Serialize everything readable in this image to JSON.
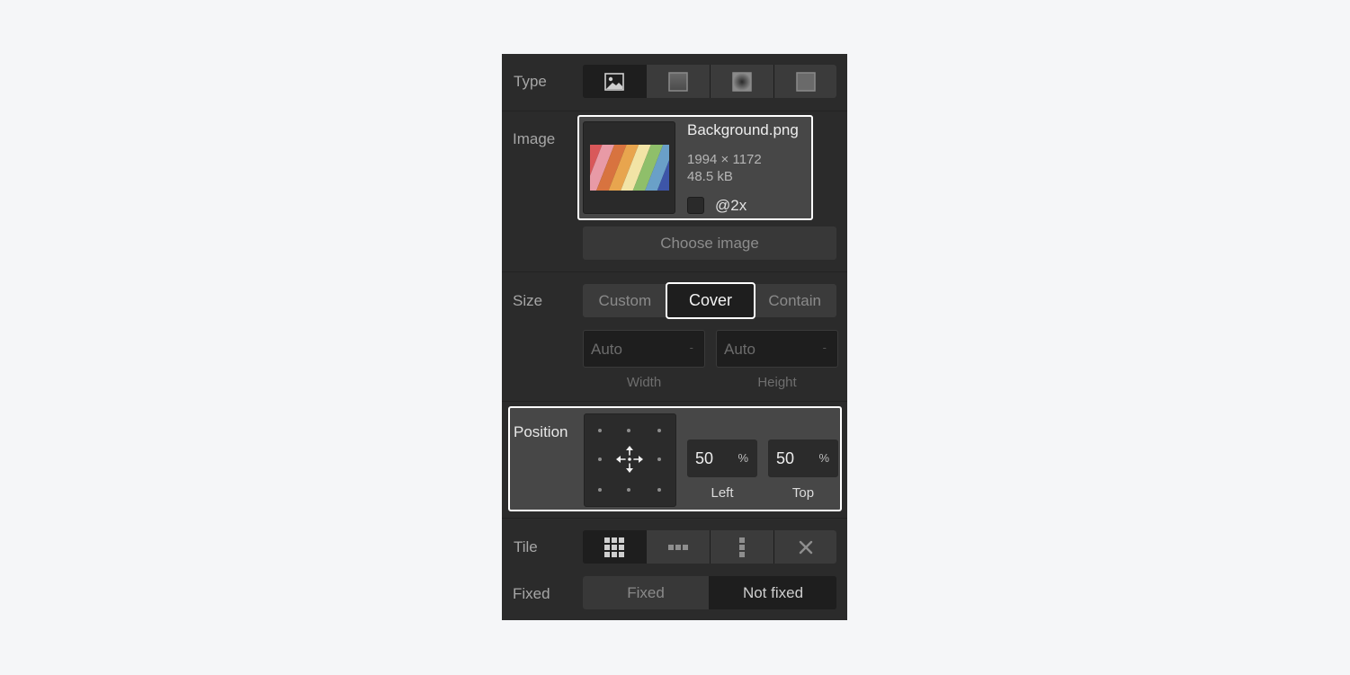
{
  "type": {
    "label": "Type",
    "buttons": [
      "image-icon",
      "linear-gradient-icon",
      "radial-gradient-icon",
      "color-overlay-icon"
    ],
    "active": 0
  },
  "image": {
    "label": "Image",
    "file_name": "Background.png",
    "dimensions": "1994 × 1172",
    "file_size": "48.5 kB",
    "retina_label": "@2x",
    "choose_label": "Choose image"
  },
  "size": {
    "label": "Size",
    "options": [
      "Custom",
      "Cover",
      "Contain"
    ],
    "selected": "Cover",
    "width_value": "Auto",
    "width_unit": "-",
    "height_value": "Auto",
    "height_unit": "-",
    "width_label": "Width",
    "height_label": "Height"
  },
  "position": {
    "label": "Position",
    "left_value": "50",
    "left_unit": "%",
    "left_label": "Left",
    "top_value": "50",
    "top_unit": "%",
    "top_label": "Top"
  },
  "tile": {
    "label": "Tile",
    "buttons": [
      "tile-both-icon",
      "tile-horizontal-icon",
      "tile-vertical-icon",
      "no-tile-icon"
    ],
    "active": 0
  },
  "fixed": {
    "label": "Fixed",
    "options": [
      "Fixed",
      "Not fixed"
    ],
    "selected": "Not fixed"
  },
  "colors": {
    "panel": "#2b2b2b",
    "highlight": "#ffffff",
    "active_button": "#1e1e1e",
    "button": "#3b3b3b",
    "page": "#f5f6f8"
  },
  "thumbnail_stripes": [
    "#d9585a",
    "#e89aa6",
    "#d8733f",
    "#e8a54e",
    "#f2e4a6",
    "#8fbf6a",
    "#6aa0c8",
    "#3d55a8"
  ]
}
